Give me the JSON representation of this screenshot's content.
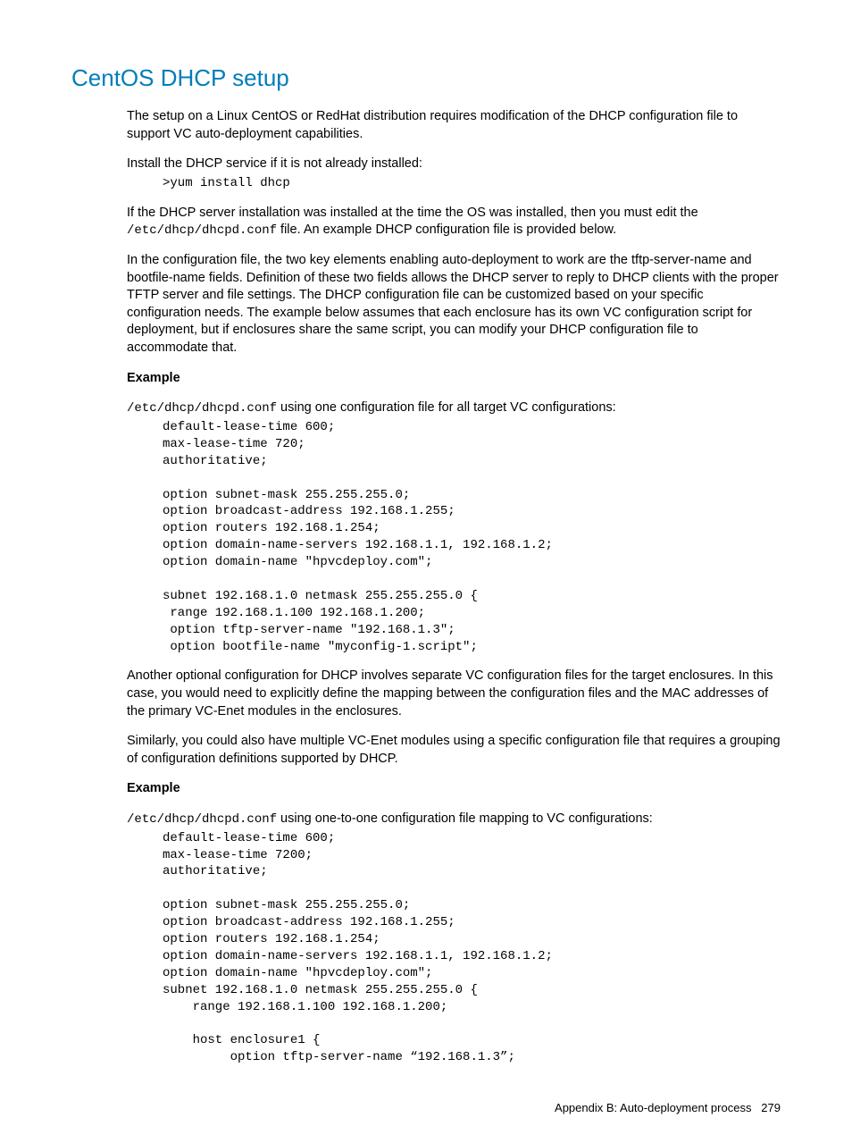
{
  "heading": "CentOS DHCP setup",
  "p1": "The setup on a Linux CentOS or RedHat distribution requires modification of the DHCP configuration file to support VC auto-deployment capabilities.",
  "p2": "Install the DHCP service if it is not already installed:",
  "cmd1": ">yum install dhcp",
  "p3a": "If the DHCP server installation was installed at the time the OS was installed, then you must edit the ",
  "p3code": "/etc/dhcp/dhcpd.conf",
  "p3b": " file. An example DHCP configuration file is provided below.",
  "p4": "In the configuration file, the two key elements enabling auto-deployment to work are the tftp-server-name and bootfile-name fields. Definition of these two fields allows the DHCP server to reply to DHCP clients with the proper TFTP server and file settings. The DHCP configuration file can be customized based on your specific configuration needs. The example below assumes that each enclosure has its own VC configuration script for deployment, but if enclosures share the same script, you can modify your DHCP configuration file to accommodate that.",
  "ex1": "Example",
  "p5code": "/etc/dhcp/dhcpd.conf",
  "p5b": " using one configuration file for all target VC configurations:",
  "code1": "default-lease-time 600;\nmax-lease-time 720;\nauthoritative;\n\noption subnet-mask 255.255.255.0;\noption broadcast-address 192.168.1.255;\noption routers 192.168.1.254;\noption domain-name-servers 192.168.1.1, 192.168.1.2;\noption domain-name \"hpvcdeploy.com\";\n\nsubnet 192.168.1.0 netmask 255.255.255.0 {\n range 192.168.1.100 192.168.1.200;\n option tftp-server-name \"192.168.1.3\";\n option bootfile-name \"myconfig-1.script\";",
  "p6": "Another optional configuration for DHCP involves separate VC configuration files for the target enclosures. In this case, you would need to explicitly define the mapping between the configuration files and the MAC addresses of the primary VC-Enet modules in the enclosures.",
  "p7": "Similarly, you could also have multiple VC-Enet modules using a specific configuration file that requires a grouping of configuration definitions supported by DHCP.",
  "ex2": "Example",
  "p8code": "/etc/dhcp/dhcpd.conf",
  "p8b": " using one-to-one configuration file mapping to VC configurations:",
  "code2": "default-lease-time 600;\nmax-lease-time 7200;\nauthoritative;\n\noption subnet-mask 255.255.255.0;\noption broadcast-address 192.168.1.255;\noption routers 192.168.1.254;\noption domain-name-servers 192.168.1.1, 192.168.1.2;\noption domain-name \"hpvcdeploy.com\";\nsubnet 192.168.1.0 netmask 255.255.255.0 {\n    range 192.168.1.100 192.168.1.200;\n\n    host enclosure1 {\n         option tftp-server-name “192.168.1.3”;",
  "footerLabel": "Appendix B: Auto-deployment process",
  "footerPage": "279"
}
